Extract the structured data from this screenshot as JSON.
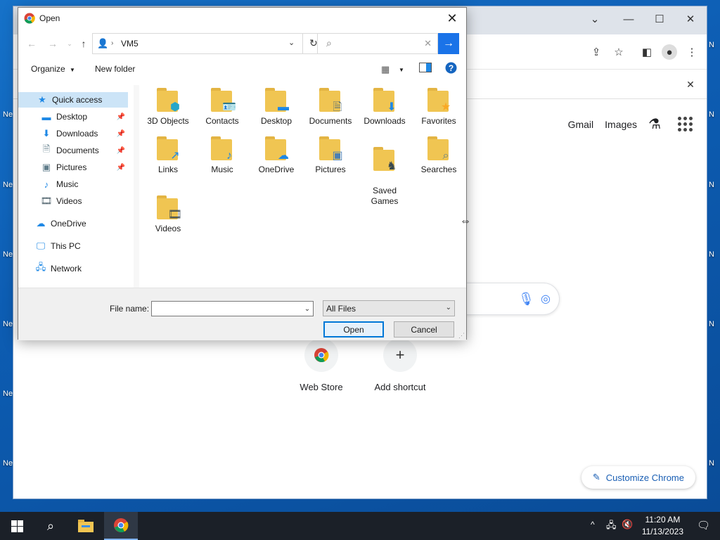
{
  "desktop": {
    "left_fragments": [
      "Ne",
      "Ne",
      "Ne",
      "Ne",
      "Ne",
      "Ne"
    ],
    "right_fragments": [
      "N",
      "N",
      "N",
      "N",
      "N",
      "N"
    ]
  },
  "chrome": {
    "top_links": [
      "Gmail",
      "Images"
    ],
    "shortcuts": [
      {
        "label": "Web Store",
        "icon": "chrome-web-store-icon"
      },
      {
        "label": "Add shortcut",
        "icon": "plus-icon",
        "glyph": "+"
      }
    ],
    "customize_label": "Customize Chrome"
  },
  "dialog": {
    "title": "Open",
    "address_path": "VM5",
    "search_placeholder": "",
    "organize_label": "Organize",
    "new_folder_label": "New folder",
    "nav_pane": [
      {
        "label": "Quick access",
        "icon": "star-icon",
        "selected": true
      },
      {
        "label": "Desktop",
        "icon": "desktop-icon",
        "pinned": true
      },
      {
        "label": "Downloads",
        "icon": "download-arrow-icon",
        "pinned": true
      },
      {
        "label": "Documents",
        "icon": "document-icon",
        "pinned": true
      },
      {
        "label": "Pictures",
        "icon": "pictures-icon",
        "pinned": true
      },
      {
        "label": "Music",
        "icon": "music-note-icon"
      },
      {
        "label": "Videos",
        "icon": "film-icon"
      },
      {
        "label": "OneDrive",
        "icon": "cloud-icon"
      },
      {
        "label": "This PC",
        "icon": "computer-icon"
      },
      {
        "label": "Network",
        "icon": "network-icon"
      }
    ],
    "folders": [
      {
        "label": "3D Objects",
        "icon": "3d-objects-icon"
      },
      {
        "label": "Contacts",
        "icon": "contacts-icon"
      },
      {
        "label": "Desktop",
        "icon": "desktop-icon"
      },
      {
        "label": "Documents",
        "icon": "document-icon"
      },
      {
        "label": "Downloads",
        "icon": "download-arrow-icon"
      },
      {
        "label": "Favorites",
        "icon": "star-icon"
      },
      {
        "label": "Links",
        "icon": "link-arrow-icon"
      },
      {
        "label": "Music",
        "icon": "music-note-icon"
      },
      {
        "label": "OneDrive",
        "icon": "cloud-icon"
      },
      {
        "label": "Pictures",
        "icon": "pictures-icon"
      },
      {
        "label": "Saved\nGames",
        "icon": "chess-piece-icon"
      },
      {
        "label": "Searches",
        "icon": "magnifier-icon"
      },
      {
        "label": "Videos",
        "icon": "film-icon"
      }
    ],
    "file_name_label": "File name:",
    "file_name_value": "",
    "file_type": "All Files",
    "open_label": "Open",
    "cancel_label": "Cancel"
  },
  "taskbar": {
    "time": "11:20 AM",
    "date": "11/13/2023"
  },
  "colors": {
    "accent": "#1a73e8",
    "folder": "#f0c552",
    "selected_nav": "#cce4f7",
    "taskbar": "#1b2028"
  }
}
